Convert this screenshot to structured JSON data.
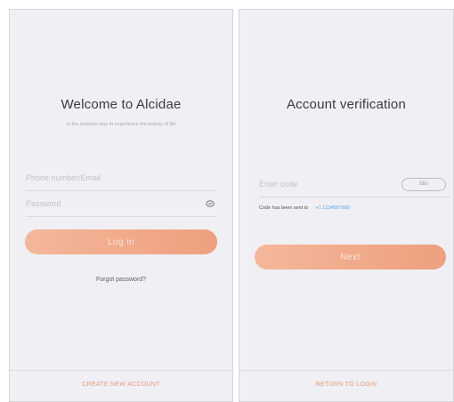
{
  "login": {
    "title": "Welcome to Alcidae",
    "subtitle": "In the simplest way to experience the beauty of life",
    "phone_placeholder": "Phone number/Email",
    "password_placeholder": "Password",
    "login_button": "Log in",
    "forgot_password": "Forgot password?",
    "create_account": "CREATE NEW ACCOUNT"
  },
  "verify": {
    "title": "Account verification",
    "code_placeholder": "Enter code",
    "timer": "58s",
    "sent_label": "Code has been sent to",
    "phone_number": "+1 1234567890",
    "next_button": "Next",
    "return_login": "RETURN TO LOGIN"
  },
  "colors": {
    "accent": "#ee9f7e",
    "link": "#5aa6e6",
    "background": "#efeff4"
  },
  "icons": {
    "password_toggle": "eye-icon"
  }
}
